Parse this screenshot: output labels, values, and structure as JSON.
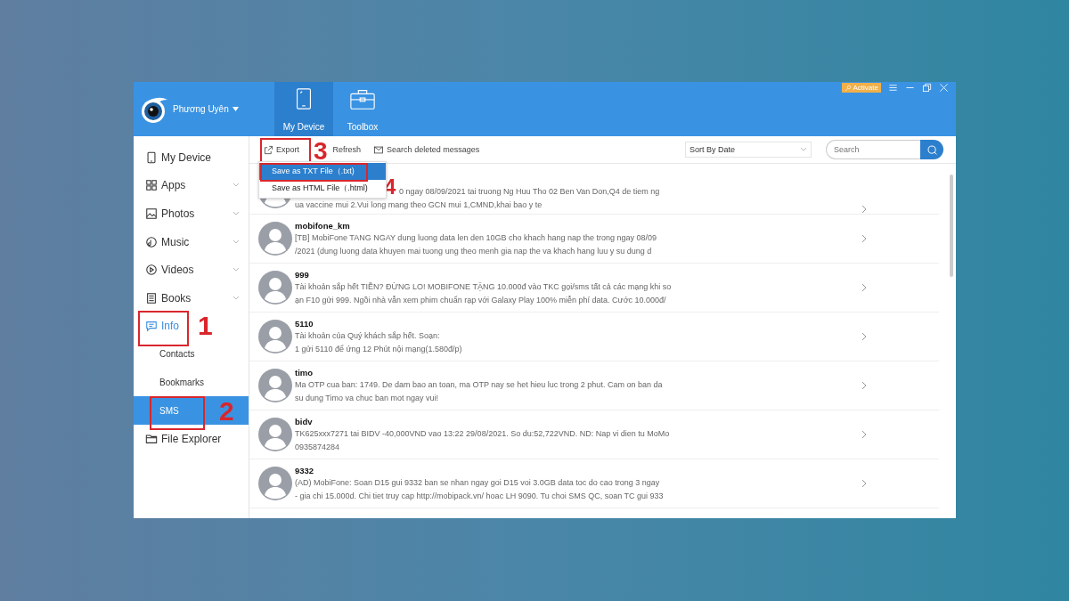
{
  "header": {
    "user": "Phương Uyên",
    "activate": "Activate",
    "tabs": [
      {
        "label": "My Device",
        "selected": true
      },
      {
        "label": "Toolbox",
        "selected": false
      }
    ]
  },
  "sidebar": {
    "items": [
      {
        "label": "My Device",
        "expandable": false,
        "selected": false
      },
      {
        "label": "Apps",
        "expandable": true,
        "selected": false
      },
      {
        "label": "Photos",
        "expandable": true,
        "selected": false
      },
      {
        "label": "Music",
        "expandable": true,
        "selected": false
      },
      {
        "label": "Videos",
        "expandable": true,
        "selected": false
      },
      {
        "label": "Books",
        "expandable": true,
        "selected": false
      },
      {
        "label": "Info",
        "expandable": false,
        "selected": true,
        "callout": "1",
        "children": [
          {
            "label": "Contacts",
            "selected": false
          },
          {
            "label": "Bookmarks",
            "selected": false
          },
          {
            "label": "SMS",
            "selected": true,
            "callout": "2"
          }
        ]
      },
      {
        "label": "File Explorer",
        "expandable": false,
        "selected": false
      }
    ]
  },
  "toolbar": {
    "export": {
      "label": "Export",
      "callout": "3"
    },
    "refresh": "Refresh",
    "search_deleted": "Search deleted messages",
    "sort": "Sort By Date",
    "search_placeholder": "Search"
  },
  "export_menu": {
    "items": [
      {
        "label": "Save as TXT File（.txt)",
        "selected": true,
        "callout": "4"
      },
      {
        "label": "Save as HTML File（.html)",
        "selected": false
      }
    ]
  },
  "messages": [
    {
      "kind": "covered",
      "lines": [
        "0 ngay 08/09/2021 tai truong Ng Huu Tho 02 Ben Van Don,Q4 de tiem ng",
        "ua vaccine mui 2.Vui long mang theo GCN mui 1,CMND,khai bao y te"
      ]
    },
    {
      "kind": "message",
      "name": "mobifone_km",
      "lines": [
        "[TB] MobiFone TANG NGAY dung luong data len den 10GB cho khach hang nap the trong ngay 08/09",
        "/2021 (dung luong data khuyen mai tuong ung theo menh gia nap the va khach hang luu y su dung d"
      ]
    },
    {
      "kind": "message",
      "name": "999",
      "lines": [
        "Tài khoản sắp hết TIỀN? ĐỪNG LO! MOBIFONE TẶNG 10.000đ vào TKC gọi/sms tất cả các mạng khi so",
        "ạn F10 gửi 999. Ngồi nhà vẫn xem phim chuẩn rạp với Galaxy Play 100% miễn phí data. Cước 10.000đ/"
      ]
    },
    {
      "kind": "message",
      "name": "5110",
      "lines": [
        "Tài khoản của Quý khách sắp hết. Soạn:",
        "1 gửi 5110 để ứng 12 Phút nội mạng(1.580đ/p)"
      ]
    },
    {
      "kind": "message",
      "name": "timo",
      "lines": [
        "Ma OTP cua ban: 1749. De dam bao an toan, ma OTP nay se het hieu luc trong 2 phut. Cam on ban da",
        "su dung Timo va chuc ban mot ngay vui!"
      ]
    },
    {
      "kind": "message",
      "name": "bidv",
      "lines": [
        "TK625xxx7271 tai BIDV -40,000VND vao 13:22 29/08/2021. So du:52,722VND. ND: Nap vi dien tu MoMo",
        " 0935874284"
      ]
    },
    {
      "kind": "message",
      "name": "9332",
      "lines": [
        "(AD) MobiFone: Soan D15 gui 9332 ban se nhan ngay goi D15 voi 3.0GB data toc do cao trong 3 ngay",
        "- gia chi 15.000d. Chi tiet truy cap http://mobipack.vn/ hoac LH 9090. Tu choi SMS QC, soan TC gui 933"
      ]
    }
  ]
}
